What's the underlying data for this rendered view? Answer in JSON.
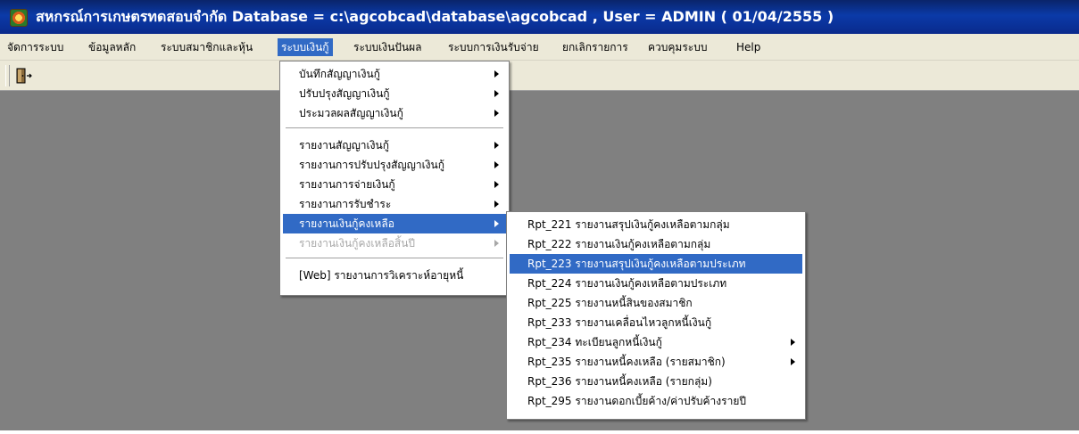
{
  "window": {
    "title": "สหกรณ์การเกษตรทดสอบจำกัด  Database = c:\\agcobcad\\database\\agcobcad , User = ADMIN ( 01/04/2555 )"
  },
  "menubar": {
    "items": [
      {
        "label": "จัดการระบบ"
      },
      {
        "label": "ข้อมูลหลัก"
      },
      {
        "label": "ระบบสมาชิกและหุ้น"
      },
      {
        "label": "ระบบเงินกู้"
      },
      {
        "label": "ระบบเงินปันผล"
      },
      {
        "label": "ระบบการเงินรับจ่าย"
      },
      {
        "label": "ยกเลิกรายการ"
      },
      {
        "label": "ควบคุมระบบ"
      },
      {
        "label": "Help"
      }
    ]
  },
  "toolbar": {
    "exit_icon": "exit-door-icon"
  },
  "loan_menu": {
    "items": [
      {
        "label": "บันทึกสัญญาเงินกู้"
      },
      {
        "label": "ปรับปรุงสัญญาเงินกู้"
      },
      {
        "label": "ประมวลผลสัญญาเงินกู้"
      },
      {
        "label": "รายงานสัญญาเงินกู้"
      },
      {
        "label": "รายงานการปรับปรุงสัญญาเงินกู้"
      },
      {
        "label": "รายงานการจ่ายเงินกู้"
      },
      {
        "label": "รายงานการรับชำระ"
      },
      {
        "label": "รายงานเงินกู้คงเหลือ"
      },
      {
        "label": "รายงานเงินกู้คงเหลือสิ้นปี"
      },
      {
        "label": "[Web] รายงานการวิเคราะห์อายุหนี้"
      }
    ]
  },
  "balance_submenu": {
    "items": [
      {
        "label": "Rpt_221 รายงานสรุปเงินกู้คงเหลือตามกลุ่ม"
      },
      {
        "label": "Rpt_222 รายงานเงินกู้คงเหลือตามกลุ่ม"
      },
      {
        "label": "Rpt_223 รายงานสรุปเงินกู้คงเหลือตามประเภท"
      },
      {
        "label": "Rpt_224 รายงานเงินกู้คงเหลือตามประเภท"
      },
      {
        "label": "Rpt_225 รายงานหนี้สินของสมาชิก"
      },
      {
        "label": "Rpt_233 รายงานเคลื่อนไหวลูกหนี้เงินกู้"
      },
      {
        "label": "Rpt_234 ทะเบียนลูกหนี้เงินกู้"
      },
      {
        "label": "Rpt_235 รายงานหนี้คงเหลือ (รายสมาชิก)"
      },
      {
        "label": "Rpt_236 รายงานหนี้คงเหลือ (รายกลุ่ม)"
      },
      {
        "label": "Rpt_295 รายงานดอกเบี้ยค้าง/ค่าปรับค้างรายปี"
      }
    ]
  },
  "colors": {
    "highlight": "#316ac5",
    "titlebar": "#0a246a",
    "desktop": "#808080"
  }
}
